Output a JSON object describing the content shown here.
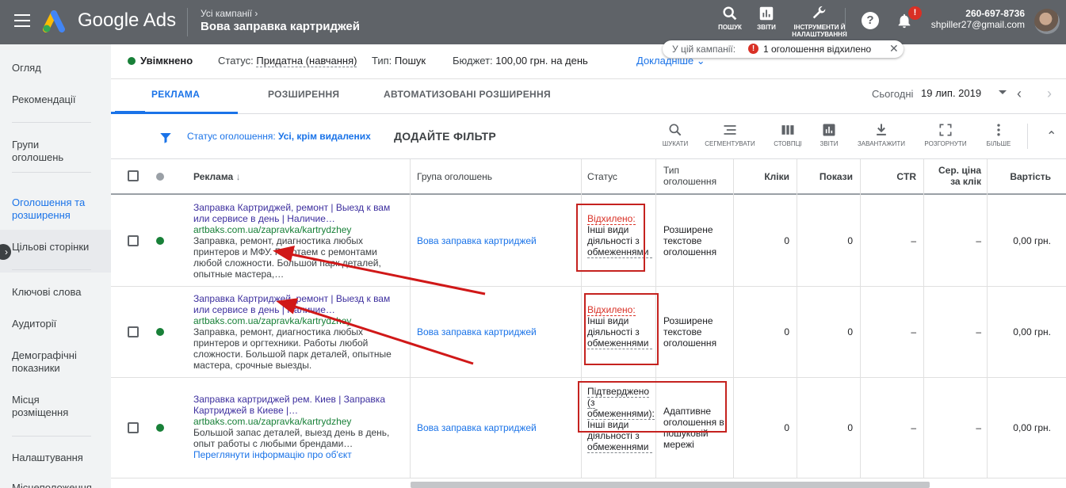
{
  "topbar": {
    "brand": "Google Ads",
    "breadcrumb": "Усі кампанії",
    "campaign_title": "Вова заправка картриджей",
    "tools": [
      {
        "label": "ПОШУК",
        "icon": "search-icon"
      },
      {
        "label": "ЗВІТИ",
        "icon": "reports-icon"
      },
      {
        "label": "ІНСТРУМЕНТИ Й НАЛАШТУВАННЯ",
        "icon": "wrench-icon"
      }
    ],
    "help_icon": "?",
    "notification_badge": "!",
    "phone": "260-697-8736",
    "email": "shpiller27@gmail.com"
  },
  "notice": {
    "label": "У цій кампанії:",
    "badge": "!",
    "message": "1 оголошення відхилено",
    "close": "✕"
  },
  "sidebar": {
    "items": [
      {
        "label": "Огляд"
      },
      {
        "label": "Рекомендації"
      },
      {
        "label": "Групи оголошень"
      },
      {
        "label": "Оголошення та розширення",
        "active": true
      },
      {
        "label": "Цільові сторінки"
      },
      {
        "label": "Ключові слова"
      },
      {
        "label": "Аудиторії"
      },
      {
        "label": "Демографічні показники"
      },
      {
        "label": "Місця розміщення"
      },
      {
        "label": "Налаштування"
      },
      {
        "label": "Місцеположення"
      }
    ]
  },
  "statusbar": {
    "enabled": "Увімкнено",
    "status_label": "Статус:",
    "status_value": "Придатна (навчання)",
    "type_label": "Тип:",
    "type_value": "Пошук",
    "budget_label": "Бюджет:",
    "budget_value": "100,00 грн. на день",
    "details": "Докладніше"
  },
  "tabs": {
    "items": [
      "РЕКЛАМА",
      "РОЗШИРЕННЯ",
      "АВТОМАТИЗОВАНІ РОЗШИРЕННЯ"
    ],
    "date_label": "Сьогодні",
    "date_value": "19 лип. 2019"
  },
  "filterbar": {
    "filter_label": "Статус оголошення:",
    "filter_value": "Усі, крім видалених",
    "add_filter": "ДОДАЙТЕ ФІЛЬТР",
    "tools": [
      {
        "label": "ШУКАТИ",
        "icon": "search-icon"
      },
      {
        "label": "СЕГМЕНТУВАТИ",
        "icon": "segment-icon"
      },
      {
        "label": "СТОВПЦІ",
        "icon": "columns-icon"
      },
      {
        "label": "ЗВІТИ",
        "icon": "reports-icon"
      },
      {
        "label": "ЗАВАНТАЖИТИ",
        "icon": "download-icon"
      },
      {
        "label": "РОЗГОРНУТИ",
        "icon": "expand-icon"
      },
      {
        "label": "БІЛЬШЕ",
        "icon": "more-icon"
      }
    ]
  },
  "table": {
    "columns": {
      "ad": "Реклама",
      "group": "Група оголошень",
      "status": "Статус",
      "type": "Тип оголошення",
      "clicks": "Кліки",
      "impressions": "Покази",
      "ctr": "CTR",
      "cpc": "Сер. ціна за клік",
      "cost": "Вартість"
    },
    "rows": [
      {
        "headline": "Заправка Картриджей, ремонт | Выезд к вам или сервисе в день | Наличие…",
        "url": "artbaks.com.ua/zapravka/kartrydzhey",
        "desc": "Заправка, ремонт, диагностика любых принтеров и МФУ. Работаем с ремонтами любой сложности. Большой парк деталей, опытные мастера,…",
        "group": "Вова заправка картриджей",
        "status_main": "Відхилено:",
        "status_sub": "Інші види діяльності з обмеженнями",
        "type": "Розширене текстове оголошення",
        "clicks": "0",
        "impressions": "0",
        "ctr": "–",
        "cpc": "–",
        "cost": "0,00 грн."
      },
      {
        "headline": "Заправка Картриджей, ремонт | Выезд к вам или сервисе в день | Наличие…",
        "url": "artbaks.com.ua/zapravka/kartrydzhey",
        "desc": "Заправка, ремонт, диагностика любых принтеров и оргтехники. Работы любой сложности. Большой парк деталей, опытные мастера, срочные выезды.",
        "group": "Вова заправка картриджей",
        "status_main": "Відхилено:",
        "status_sub": "Інші види діяльності з обмеженнями",
        "type": "Розширене текстове оголошення",
        "clicks": "0",
        "impressions": "0",
        "ctr": "–",
        "cpc": "–",
        "cost": "0,00 грн."
      },
      {
        "headline": "Заправка картриджей рем. Киев | Заправка Картриджей в Киеве |…",
        "url": "artbaks.com.ua/zapravka/kartrydzhey",
        "desc": "Большой запас деталей, выезд день в день, опыт работы с любыми брендами…",
        "link": "Переглянути інформацію про об'єкт",
        "group": "Вова заправка картриджей",
        "status_main": "Підтверджено (з обмеженнями):",
        "status_sub": "Інші види діяльності з обмеженнями",
        "type": "Адаптивне оголошення в пошуковій мережі",
        "clicks": "0",
        "impressions": "0",
        "ctr": "–",
        "cpc": "–",
        "cost": "0,00 грн."
      }
    ]
  },
  "colors": {
    "topbar": "#5f6368",
    "accent": "#1a73e8",
    "enabled": "#188038",
    "rejected": "#d93025",
    "annotation": "#c5221f"
  }
}
